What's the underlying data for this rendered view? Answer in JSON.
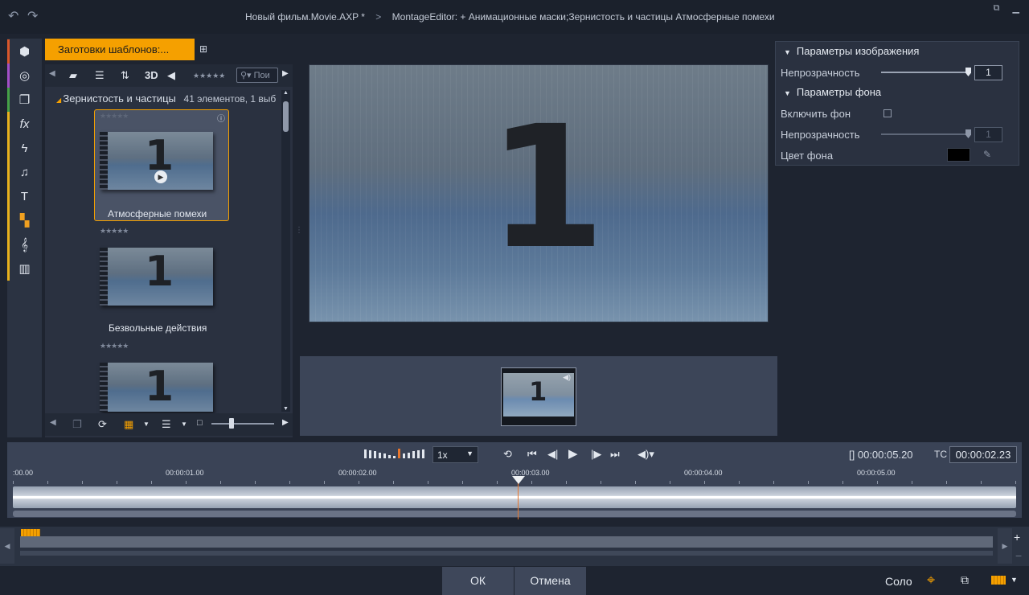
{
  "window": {
    "project_title": "Новый фильм.Movie.AXP",
    "modified_mark": "*",
    "breadcrumb_sep": ">",
    "editor_title": "MontageEditor: + Анимационные маски;Зернистость и частицы  Атмосферные помехи",
    "undo_icon": "undo-icon",
    "redo_icon": "redo-icon"
  },
  "rail": {
    "items": [
      {
        "icon": "package-icon",
        "glyph": "⬢",
        "stripe": "#d9572b"
      },
      {
        "icon": "reel-icon",
        "glyph": "◎",
        "stripe": "#a34fc7"
      },
      {
        "icon": "layers-icon",
        "glyph": "❐",
        "stripe": "#45a147"
      },
      {
        "icon": "fx-icon",
        "glyph": "fx",
        "stripe": "#e8b21d"
      },
      {
        "icon": "flash-icon",
        "glyph": "ϟ",
        "stripe": "#e8b21d"
      },
      {
        "icon": "music-note-icon",
        "glyph": "♫",
        "stripe": "#e8b21d"
      },
      {
        "icon": "title-icon",
        "glyph": "T",
        "stripe": "#e8b21d"
      },
      {
        "icon": "mask-icon",
        "glyph": "▚",
        "stripe": "#e8b21d",
        "active": true
      },
      {
        "icon": "treble-clef-icon",
        "glyph": "𝄞",
        "stripe": "#e8b21d"
      },
      {
        "icon": "piano-icon",
        "glyph": "▥",
        "stripe": "#e8b21d"
      }
    ]
  },
  "library": {
    "tab_label": "Заготовки шаблонов:...",
    "label_3d": "3D",
    "search_placeholder": "Пои",
    "crumb_folder": "Зернистость и частицы",
    "crumb_count": "41 элементов, 1 выб",
    "items": [
      {
        "label": "Атмосферные помехи",
        "selected": true
      },
      {
        "label": "Безвольные действия",
        "selected": false
      },
      {
        "label": "",
        "selected": false
      }
    ]
  },
  "preview": {
    "frame_number": "1"
  },
  "clip_strip": {
    "thumb_number": "1"
  },
  "properties": {
    "image_section": "Параметры изображения",
    "image_opacity_label": "Непрозрачность",
    "image_opacity_value": "1",
    "image_opacity_level": 1.0,
    "bg_section": "Параметры фона",
    "bg_enable_label": "Включить фон",
    "bg_opacity_label": "Непрозрачность",
    "bg_opacity_value": "1",
    "bg_opacity_level": 1.0,
    "bg_color_label": "Цвет фона",
    "bg_color": "#000000"
  },
  "transport": {
    "speed": "1x",
    "duration_prefix": "[]",
    "duration": "00:00:05.20",
    "tc_label": "TC",
    "timecode": "00:00:02.23"
  },
  "timeline": {
    "ticks": [
      ":00.00",
      "00:00:01.00",
      "00:00:02.00",
      "00:00:03.00",
      "00:00:04.00",
      "00:00:05.00"
    ],
    "playhead_seconds": 2.92
  },
  "bottom": {
    "ok_label": "ОК",
    "cancel_label": "Отмена",
    "solo_label": "Соло"
  },
  "colors": {
    "accent": "#f5a000",
    "playhead": "#e8762d",
    "background": "#1e2430"
  }
}
